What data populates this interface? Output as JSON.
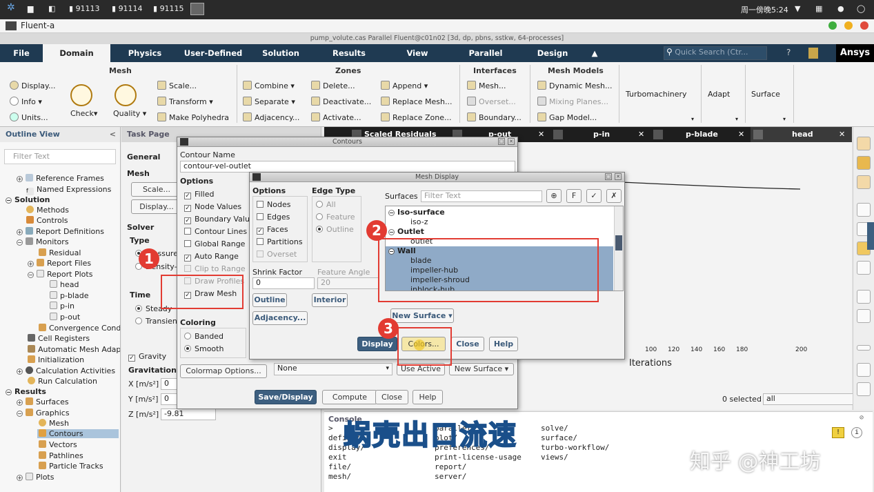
{
  "sysbar": {
    "tasks": [
      "91113",
      "91114",
      "91115"
    ],
    "clock": "周一傍晚5:24"
  },
  "app": {
    "name": "Fluent-a",
    "window_title": "pump_volute.cas Parallel Fluent@c01n02  [3d, dp, pbns, sstkw, 64-processes]"
  },
  "ribbon_tabs": [
    "File",
    "Domain",
    "Physics",
    "User-Defined",
    "Solution",
    "Results",
    "View",
    "Parallel",
    "Design"
  ],
  "quick_search": "Quick Search (Ctr...",
  "brand": "Ansys",
  "ribbon": {
    "mesh": {
      "title": "Mesh",
      "display": "Display...",
      "info": "Info",
      "units": "Units...",
      "check": "Check",
      "quality": "Quality",
      "scale": "Scale...",
      "transform": "Transform",
      "make_polyhedra": "Make Polyhedra"
    },
    "zones": {
      "title": "Zones",
      "combine": "Combine",
      "separate": "Separate",
      "adjacency": "Adjacency...",
      "delete": "Delete...",
      "deactivate": "Deactivate...",
      "activate": "Activate...",
      "append": "Append",
      "replace_mesh": "Replace Mesh...",
      "replace_zone": "Replace Zone..."
    },
    "interfaces": {
      "title": "Interfaces",
      "mesh": "Mesh...",
      "overset": "Overset...",
      "boundary": "Boundary..."
    },
    "mesh_models": {
      "title": "Mesh Models",
      "dynamic_mesh": "Dynamic Mesh...",
      "mixing_planes": "Mixing Planes...",
      "gap_model": "Gap Model..."
    },
    "turbomachinery": "Turbomachinery",
    "adapt": "Adapt",
    "surface": "Surface"
  },
  "outline": {
    "title": "Outline View",
    "filter_placeholder": "Filter Text",
    "items": [
      "Reference Frames",
      "Named Expressions",
      "Solution",
      "Methods",
      "Controls",
      "Report Definitions",
      "Monitors",
      "Residual",
      "Report Files",
      "Report Plots",
      "head",
      "p-blade",
      "p-in",
      "p-out",
      "Convergence Conditions",
      "Cell Registers",
      "Automatic Mesh Adaption",
      "Initialization",
      "Calculation Activities",
      "Run Calculation",
      "Results",
      "Surfaces",
      "Graphics",
      "Mesh",
      "Contours",
      "Vectors",
      "Pathlines",
      "Particle Tracks",
      "Plots"
    ]
  },
  "task_page": {
    "title": "Task Page",
    "general": "General",
    "mesh_label": "Mesh",
    "scale_btn": "Scale...",
    "display_btn": "Display...",
    "solver": "Solver",
    "type": "Type",
    "type_opt1": "Pressure-Based",
    "type_opt2": "Density-Based",
    "time": "Time",
    "steady": "Steady",
    "transient": "Transient",
    "gravity": "Gravity",
    "gravitational": "Gravitational Acceleration",
    "x_label": "X [m/s²]",
    "x_val": "0",
    "y_label": "Y [m/s²]",
    "y_val": "0",
    "z_label": "Z [m/s²]",
    "z_val": "-9.81"
  },
  "graphics_tabs": [
    "Scaled Residuals",
    "p-out",
    "p-in",
    "p-blade",
    "head"
  ],
  "plot": {
    "xlabel": "Iterations",
    "ticks": [
      "100",
      "120",
      "140",
      "160",
      "180",
      "200"
    ],
    "selected_count": "0 selected",
    "filter_value": "all"
  },
  "contours": {
    "title": "Contours",
    "name_label": "Contour Name",
    "name_value": "contour-vel-outlet",
    "options_title": "Options",
    "options": [
      {
        "label": "Filled",
        "checked": true,
        "disabled": false
      },
      {
        "label": "Node Values",
        "checked": true,
        "disabled": false
      },
      {
        "label": "Boundary Values",
        "checked": true,
        "disabled": false
      },
      {
        "label": "Contour Lines",
        "checked": false,
        "disabled": false
      },
      {
        "label": "Global Range",
        "checked": false,
        "disabled": false
      },
      {
        "label": "Auto Range",
        "checked": true,
        "disabled": false
      },
      {
        "label": "Clip to Range",
        "checked": false,
        "disabled": true
      },
      {
        "label": "Draw Profiles",
        "checked": false,
        "disabled": true
      },
      {
        "label": "Draw Mesh",
        "checked": true,
        "disabled": false
      }
    ],
    "coloring_title": "Coloring",
    "banded": "Banded",
    "smooth": "Smooth",
    "colormap_btn": "Colormap Options...",
    "surface_select": "None",
    "use_active": "Use Active",
    "new_surface": "New Surface",
    "save_display": "Save/Display",
    "compute": "Compute",
    "close": "Close",
    "help": "Help"
  },
  "mesh_display": {
    "title": "Mesh Display",
    "options_title": "Options",
    "options": [
      {
        "label": "Nodes",
        "checked": false,
        "disabled": false
      },
      {
        "label": "Edges",
        "checked": false,
        "disabled": false
      },
      {
        "label": "Faces",
        "checked": true,
        "disabled": false
      },
      {
        "label": "Partitions",
        "checked": false,
        "disabled": false
      },
      {
        "label": "Overset",
        "checked": false,
        "disabled": true
      }
    ],
    "edge_type_title": "Edge Type",
    "edge_types": [
      "All",
      "Feature",
      "Outline"
    ],
    "shrink_label": "Shrink Factor",
    "shrink_value": "0",
    "feature_label": "Feature Angle",
    "feature_value": "20",
    "outline_btn": "Outline",
    "interior_btn": "Interior",
    "adjacency_btn": "Adjacency...",
    "surfaces_label": "Surfaces",
    "surfaces_filter": "Filter Text",
    "groups": [
      {
        "name": "Iso-surface",
        "items": [
          "iso-z"
        ]
      },
      {
        "name": "Outlet",
        "items": [
          "outlet"
        ]
      },
      {
        "name": "Wall",
        "items": [
          "blade",
          "impeller-hub",
          "impeller-shroud",
          "inblock-hub"
        ]
      }
    ],
    "new_surface": "New Surface",
    "display": "Display",
    "colors": "Colors...",
    "close": "Close",
    "help": "Help"
  },
  "console": {
    "title": "Console",
    "col1": [
      ">",
      "define/",
      "display/",
      "exit",
      "file/",
      "mesh/"
    ],
    "col2": [
      "parallel/",
      "plot/",
      "preferences/",
      "print-license-usage",
      "report/",
      "server/"
    ],
    "col3": [
      "solve/",
      "surface/",
      "turbo-workflow/",
      "views/"
    ]
  },
  "annotations": {
    "n1": "1",
    "n2": "2",
    "n3": "3",
    "subtitle": "蜗壳出口流速",
    "watermark": "知乎 @神工坊"
  },
  "colors": {
    "ribbon_dark": "#1f3a52",
    "accent_red": "#e23b32",
    "selection": "#8faac7"
  }
}
